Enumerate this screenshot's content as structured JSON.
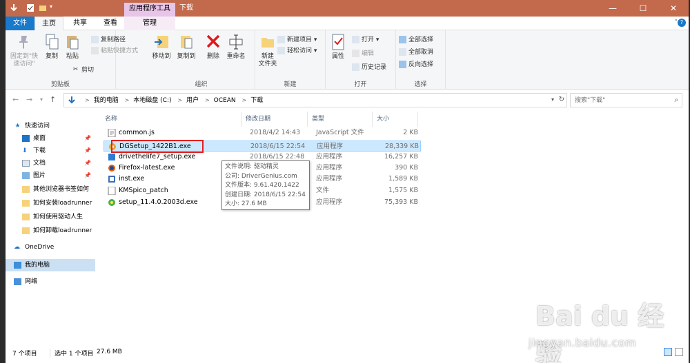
{
  "titlebar": {
    "context_tab": "应用程序工具",
    "title": "下载",
    "min": "—",
    "max": "☐",
    "close": "✕"
  },
  "tabs": {
    "file": "文件",
    "home": "主页",
    "share": "共享",
    "view": "查看",
    "manage": "管理"
  },
  "ribbon": {
    "clipboard": {
      "pin": "固定到\"快\n速访问\"",
      "copy": "复制",
      "paste": "粘贴",
      "copy_path": "复制路径",
      "paste_shortcut": "粘贴快捷方式",
      "cut": "剪切",
      "label": "剪贴板"
    },
    "organize": {
      "move_to": "移动到",
      "copy_to": "复制到",
      "delete": "删除",
      "rename": "重命名",
      "label": "组织"
    },
    "new": {
      "new_folder": "新建\n文件夹",
      "new_item": "新建项目",
      "easy_access": "轻松访问",
      "label": "新建"
    },
    "open": {
      "properties": "属性",
      "open": "打开",
      "edit": "编辑",
      "history": "历史记录",
      "label": "打开"
    },
    "select": {
      "select_all": "全部选择",
      "select_none": "全部取消",
      "invert": "反向选择",
      "label": "选择"
    }
  },
  "address": {
    "crumbs": [
      "我的电脑",
      "本地磁盘 (C:)",
      "用户",
      "OCEAN",
      "下载"
    ],
    "search_placeholder": "搜索\"下载\""
  },
  "nav": {
    "quick_access": "快速访问",
    "items": [
      "桌面",
      "下载",
      "文档",
      "图片",
      "其他浏览器书签如何",
      "如何安装loadrunner",
      "如何使用驱动人生",
      "如何卸载loadrunner"
    ],
    "onedrive": "OneDrive",
    "this_pc": "我的电脑",
    "network": "网络"
  },
  "columns": {
    "name": "名称",
    "date": "修改日期",
    "type": "类型",
    "size": "大小"
  },
  "files": [
    {
      "name": "common.js",
      "date": "2018/4/2 14:43",
      "type": "JavaScript 文件",
      "size": "2 KB",
      "icon": "js-file-icon"
    },
    {
      "name": "DGSetup_1422B1.exe",
      "date": "2018/6/15 22:54",
      "type": "应用程序",
      "size": "28,339 KB",
      "icon": "exe-icon"
    },
    {
      "name": "drivethelife7_setup.exe",
      "date": "2018/6/15 22:48",
      "type": "应用程序",
      "size": "16,257 KB",
      "icon": "exe-icon"
    },
    {
      "name": "Firefox-latest.exe",
      "date": "",
      "type": "应用程序",
      "size": "390 KB",
      "icon": "firefox-icon"
    },
    {
      "name": "inst.exe",
      "date": "",
      "type": "应用程序",
      "size": "1,589 KB",
      "icon": "exe-icon"
    },
    {
      "name": "KMSpico_patch",
      "date": "",
      "type": "文件",
      "size": "1,575 KB",
      "icon": "file-icon"
    },
    {
      "name": "setup_11.4.0.2003d.exe",
      "date": "",
      "type": "应用程序",
      "size": "75,393 KB",
      "icon": "exe-icon"
    }
  ],
  "tooltip": {
    "desc": "文件说明: 驱动精灵",
    "company": "公司: DriverGenius.com",
    "version": "文件版本: 9.61.420.1422",
    "created": "创建日期: 2018/6/15 22:54",
    "size": "大小: 27.6 MB"
  },
  "status": {
    "count": "7 个项目",
    "selected": "选中 1 个项目",
    "size": "27.6 MB"
  },
  "watermark": {
    "brand": "Bai du 经验",
    "url": "jingyan.baidu.com"
  }
}
